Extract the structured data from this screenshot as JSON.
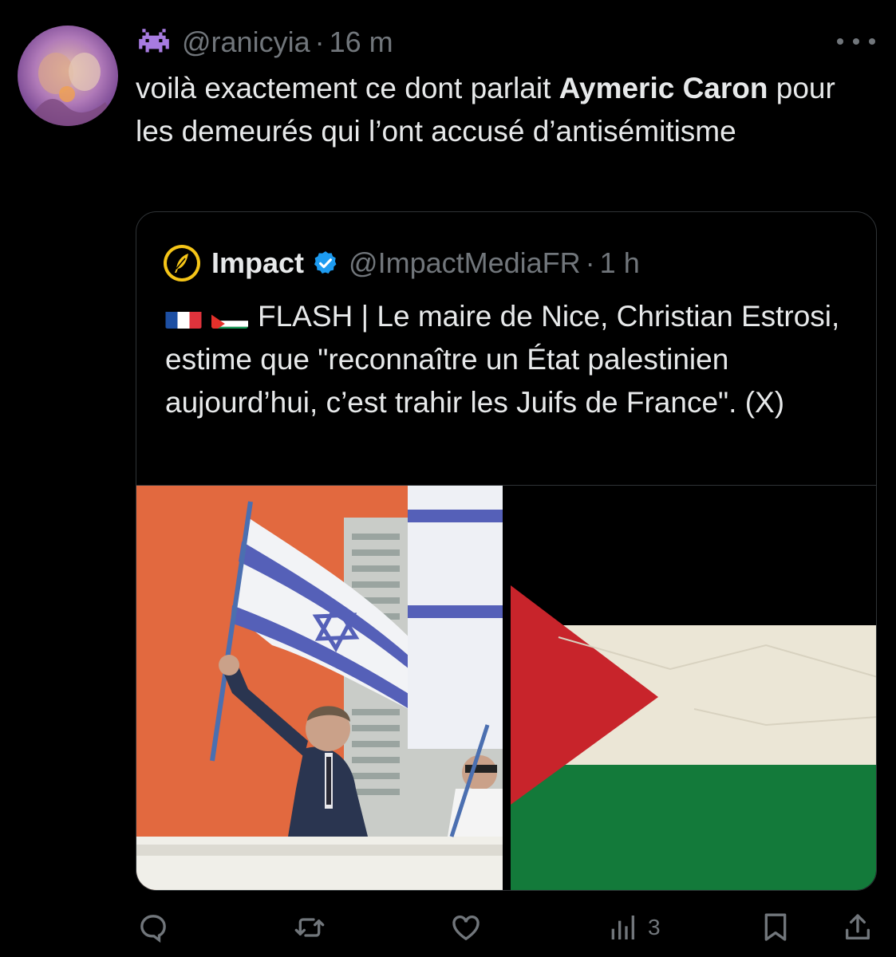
{
  "tweet": {
    "handle": "@ranicyia",
    "separator": "·",
    "time": "16 m",
    "text_part1": "voilà exactement ce dont parlait ",
    "text_bold": "Aymeric Caron",
    "text_part2": " pour les demeurés qui l’ont accusé d’antisémitisme"
  },
  "quote": {
    "name": "Impact",
    "handle": "@ImpactMediaFR",
    "separator": "·",
    "time": "1 h",
    "text": "FLASH | Le maire de Nice, Christian Estrosi, estime que \"reconnaître un État palestinien aujourd’hui, c’est trahir les Juifs de France\". (X)",
    "flags": [
      "france-flag-icon",
      "palestine-flag-icon"
    ]
  },
  "actions": {
    "reply_icon": "reply-icon",
    "retweet_icon": "retweet-icon",
    "like_icon": "heart-icon",
    "views_icon": "views-icon",
    "views_count": "3",
    "bookmark_icon": "bookmark-icon",
    "share_icon": "share-icon"
  },
  "colors": {
    "background": "#000000",
    "text": "#e7e9ea",
    "secondary": "#71767b",
    "verified": "#1d9bf0",
    "impact_logo": "#f5c518"
  }
}
